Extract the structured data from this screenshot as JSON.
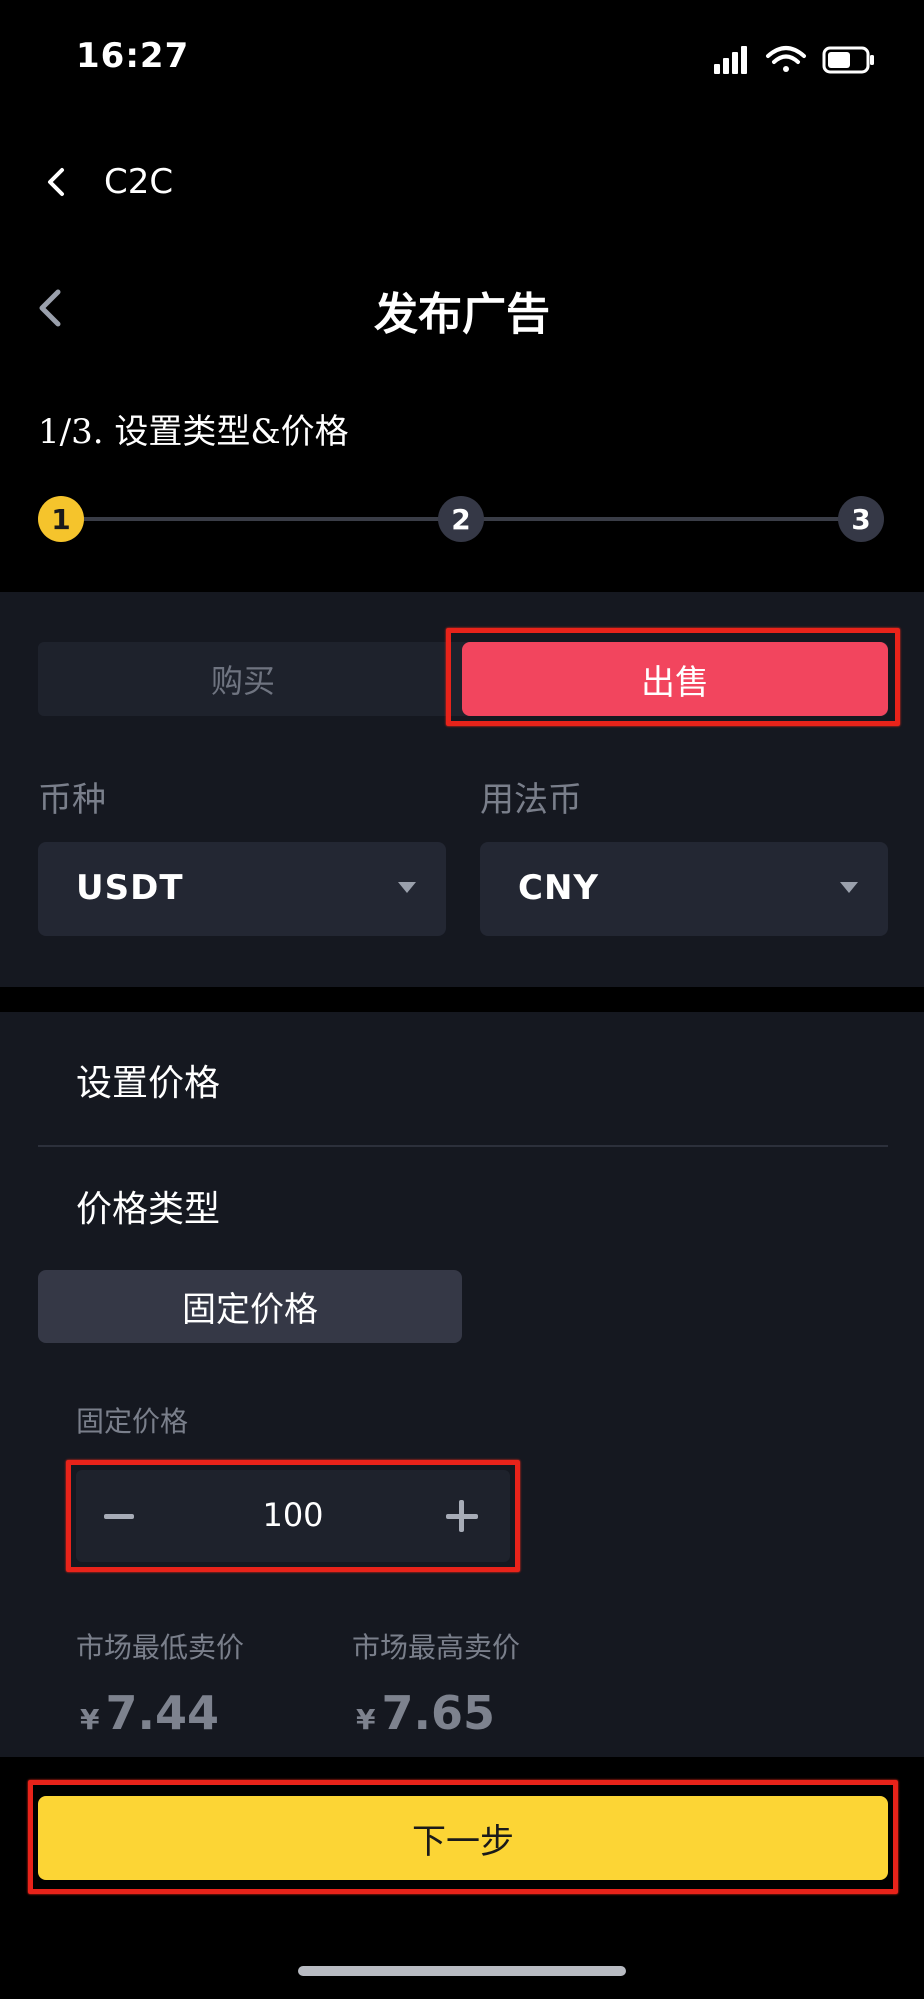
{
  "status_bar": {
    "time": "16:27"
  },
  "nav": {
    "back_label": "C2C",
    "title": "发布广告"
  },
  "step": {
    "label": "1/3. 设置类型&价格",
    "steps": [
      "1",
      "2",
      "3"
    ],
    "current": 1
  },
  "trade_type": {
    "buy_label": "购买",
    "sell_label": "出售",
    "selected": "出售"
  },
  "coin": {
    "label": "币种",
    "value": "USDT"
  },
  "fiat": {
    "label": "用法币",
    "value": "CNY"
  },
  "price": {
    "section_title": "设置价格",
    "type_title": "价格类型",
    "type_button": "固定价格",
    "fixed_label": "固定价格",
    "fixed_value": "100"
  },
  "market": {
    "min_label": "市场最低卖价",
    "min_currency": "¥",
    "min_value": "7.44",
    "max_label": "市场最高卖价",
    "max_currency": "¥",
    "max_value": "7.65"
  },
  "footer": {
    "next_label": "下一步"
  },
  "colors": {
    "accent": "#fcd535",
    "sell": "#f2455e",
    "highlight": "#e8231a"
  }
}
